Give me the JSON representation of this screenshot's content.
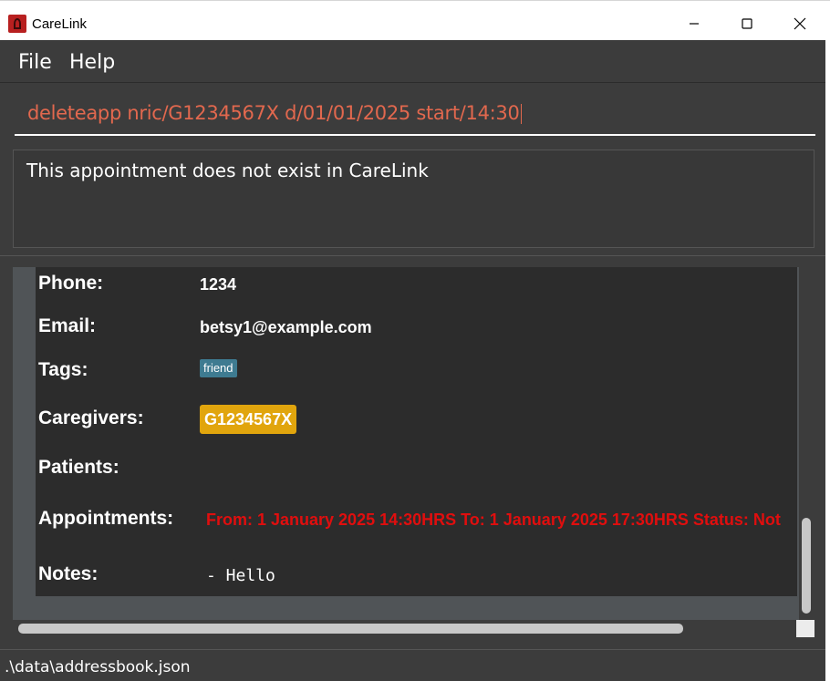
{
  "window": {
    "title": "CareLink"
  },
  "menu": {
    "file": "File",
    "help": "Help"
  },
  "command": {
    "value": "deleteapp nric/G1234567X d/01/01/2025 start/14:30"
  },
  "result": {
    "message": "This appointment does not exist in CareLink"
  },
  "person": {
    "labels": {
      "phone": "Phone:",
      "email": "Email:",
      "tags": "Tags:",
      "caregivers": "Caregivers:",
      "patients": "Patients:",
      "appointments": "Appointments:",
      "notes": "Notes:"
    },
    "phone": "1234",
    "email": "betsy1@example.com",
    "tags": [
      "friend"
    ],
    "caregivers": [
      "G1234567X"
    ],
    "appointment": "From: 1 January 2025 14:30HRS To: 1 January 2025 17:30HRS Status: Not",
    "notes": "- Hello"
  },
  "status_bar": {
    "path": ".\\data\\addressbook.json"
  },
  "colors": {
    "background": "#3c3c3c",
    "command_text": "#e2684e",
    "tag": "#3e7b91",
    "caregiver_chip": "#e1a50d",
    "appointment_text": "#e00e0e"
  },
  "icons": {
    "app": "carelink-app-icon",
    "minimize": "minimize-icon",
    "maximize": "maximize-icon",
    "close": "close-icon"
  }
}
